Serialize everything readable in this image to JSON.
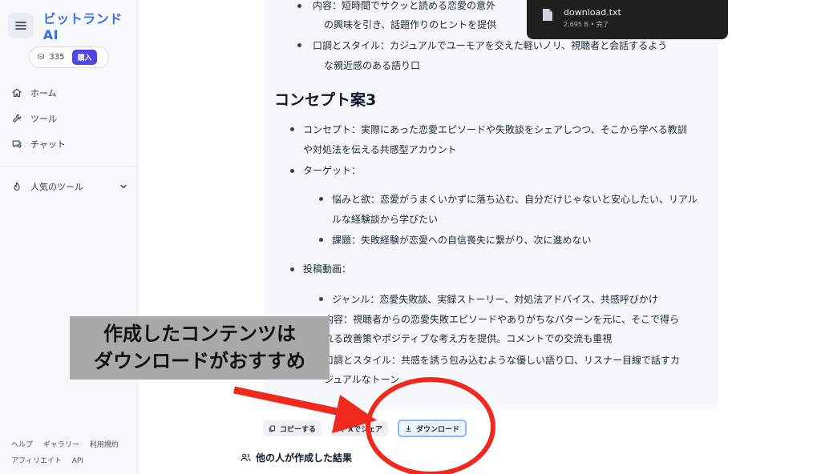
{
  "app": {
    "brand": "ビットランドAI"
  },
  "sidebar": {
    "credits": "335",
    "buy_label": "購入",
    "nav": [
      {
        "label": "ホーム",
        "icon": "home-icon"
      },
      {
        "label": "ツール",
        "icon": "wrench-icon"
      },
      {
        "label": "チャット",
        "icon": "chat-icon"
      }
    ],
    "popular_label": "人気のツール",
    "footer": [
      [
        "ヘルプ",
        "ギャラリー",
        "利用規約"
      ],
      [
        "アフィリエイト",
        "API"
      ]
    ]
  },
  "content": {
    "top_lines": [
      "内容：短時間でサクッと読める恋愛の意外",
      "の興味を引き、話題作りのヒントを提供",
      "口調とスタイル：カジュアルでユーモアを交えた軽いノリ、視聴者と会話するよう",
      "な親近感のある語り口"
    ],
    "section_title": "コンセプト案3",
    "concept_lines": [
      "コンセプト：実際にあった恋愛エピソードや失敗談をシェアしつつ、そこから学べる教訓",
      "や対処法を伝える共感型アカウント"
    ],
    "target_label": "ターゲット：",
    "target_lines": [
      "悩みと欲：恋愛がうまくいかずに落ち込む、自分だけじゃないと安心したい、リアル",
      "ルな経験談から学びたい",
      "課題：失敗経験が恋愛への自信喪失に繋がり、次に進めない"
    ],
    "posts_label": "投稿動画：",
    "posts_lines": [
      "ジャンル：恋愛失敗談、実録ストーリー、対処法アドバイス、共感呼びかけ",
      "内容：視聴者からの恋愛失敗エピソードやありがちなパターンを元に、そこで得ら",
      "れる改善策やポジティブな考え方を提供。コメントでの交流も重視",
      "口調とスタイル：共感を誘う包み込むような優しい語り口、リスナー目線で話すカ",
      "ジュアルなトーン"
    ]
  },
  "actions": {
    "copy": "コピーする",
    "share": "Xでシェア",
    "download": "ダウンロード"
  },
  "others_label": "他の人が作成した結果",
  "download_popup": {
    "filename": "download.txt",
    "meta": "2,695 B • 完了"
  },
  "annotation": {
    "line1": "作成したコンテンツは",
    "line2": "ダウンロードがおすすめ",
    "arrow_color": "#f0291f",
    "circle_color": "#f0291f"
  }
}
